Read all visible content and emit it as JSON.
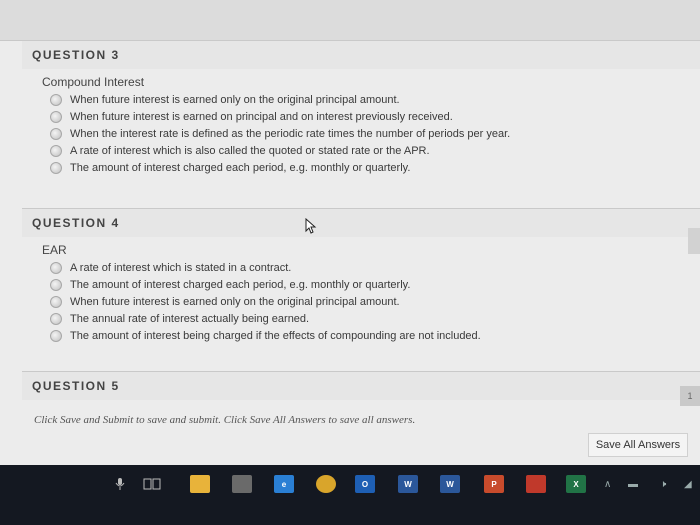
{
  "questions": [
    {
      "header": "QUESTION 3",
      "title": "Compound Interest",
      "answers": [
        "When future interest is earned only on the original principal amount.",
        "When future interest is earned on principal and on interest previously received.",
        "When the interest rate is defined as the periodic rate times the number of periods per year.",
        "A rate of interest which is also called the quoted or stated rate or the APR.",
        "The amount of interest charged each period, e.g. monthly or quarterly."
      ]
    },
    {
      "header": "QUESTION 4",
      "title": "EAR",
      "answers": [
        "A rate of interest which is stated in a contract.",
        "The amount of interest charged each period, e.g. monthly or quarterly.",
        "When future interest is earned only on the original principal amount.",
        "The annual rate of interest actually being earned.",
        "The amount of interest being charged if the effects of compounding are not included."
      ]
    },
    {
      "header": "QUESTION 5"
    }
  ],
  "page_badge": "1",
  "footer": {
    "instructions": "Click Save and Submit to save and submit. Click Save All Answers to save all answers.",
    "save_all_label": "Save All Answers"
  },
  "taskbar": {
    "icons": [
      {
        "name": "file-explorer-icon",
        "label": "",
        "color": "#e8b33a"
      },
      {
        "name": "store-icon",
        "label": "",
        "color": "#6a6a6a"
      },
      {
        "name": "edge-icon",
        "label": "e",
        "color": "#2a7fd4"
      },
      {
        "name": "chrome-icon",
        "label": "",
        "color": "#d9a52b"
      },
      {
        "name": "outlook-icon",
        "label": "O",
        "color": "#1e5fb4"
      },
      {
        "name": "word-icon",
        "label": "W",
        "color": "#2b579a"
      },
      {
        "name": "word-icon-2",
        "label": "W",
        "color": "#2b579a"
      },
      {
        "name": "powerpoint-icon",
        "label": "P",
        "color": "#c84b2c"
      },
      {
        "name": "paint-icon",
        "label": "",
        "color": "#c0392b"
      },
      {
        "name": "excel-icon",
        "label": "X",
        "color": "#217346"
      }
    ]
  }
}
